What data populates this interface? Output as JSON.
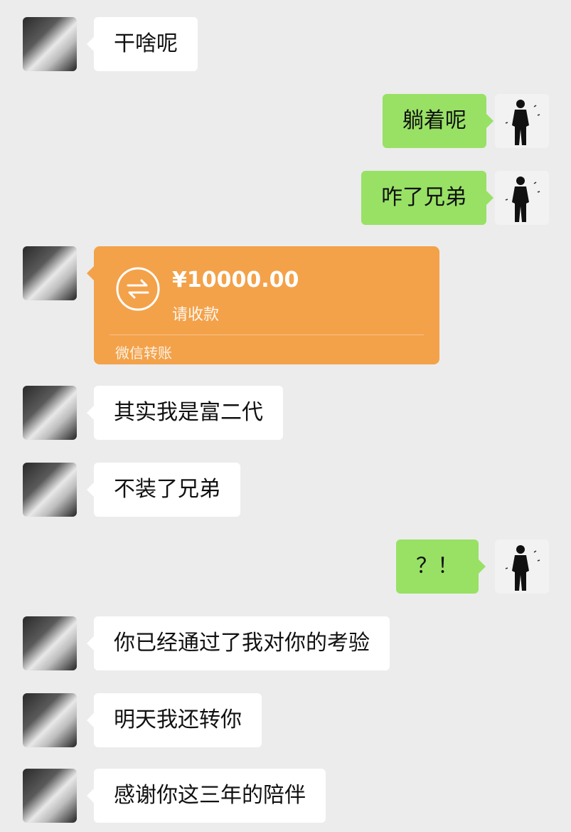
{
  "messages": [
    {
      "side": "left",
      "text": "干啥呢"
    },
    {
      "side": "right",
      "text": "躺着呢"
    },
    {
      "side": "right",
      "text": "咋了兄弟"
    },
    {
      "side": "left",
      "type": "transfer"
    },
    {
      "side": "left",
      "text": "其实我是富二代"
    },
    {
      "side": "left",
      "text": "不装了兄弟"
    },
    {
      "side": "right",
      "text": "？！"
    },
    {
      "side": "left",
      "text": "你已经通过了我对你的考验"
    },
    {
      "side": "left",
      "text": "明天我还转你"
    },
    {
      "side": "left",
      "text": "感谢你这三年的陪伴"
    }
  ],
  "transfer": {
    "amount": "¥10000.00",
    "status": "请收款",
    "label": "微信转账",
    "icon": "transfer-arrows-icon",
    "color": "#f3a24a"
  },
  "colors": {
    "background": "#ececec",
    "incoming_bubble": "#ffffff",
    "outgoing_bubble": "#98e165"
  },
  "avatars": {
    "contact": "contact-avatar",
    "self": "self-avatar"
  }
}
